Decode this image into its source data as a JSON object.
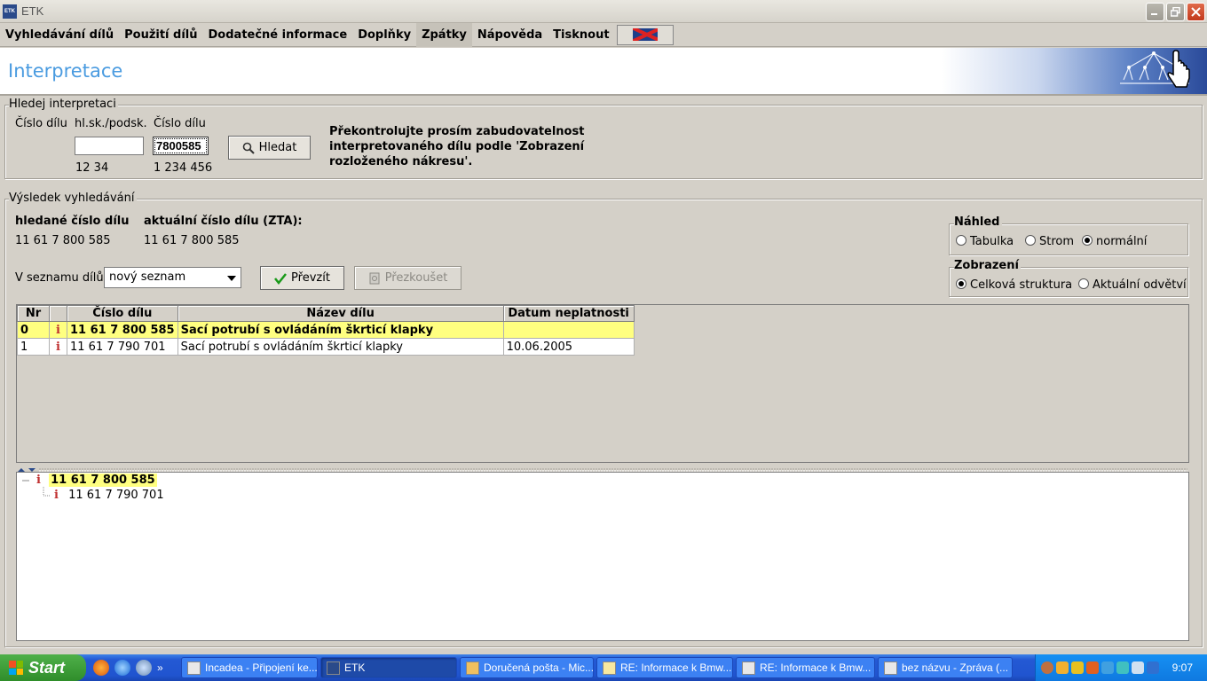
{
  "window": {
    "title": "ETK",
    "icon_label": "ETK"
  },
  "menu": [
    {
      "label": "Vyhledávání dílů"
    },
    {
      "label": "Použití dílů"
    },
    {
      "label": "Dodatečné informace"
    },
    {
      "label": "Doplňky"
    },
    {
      "label": "Zpátky",
      "active": true
    },
    {
      "label": "Nápověda"
    },
    {
      "label": "Tisknout"
    }
  ],
  "header": {
    "title": "Interpretace"
  },
  "search": {
    "group_title": "Hledej interpretaci",
    "label_cislo_dilu": "Číslo dílu",
    "label_hlsk": "hl.sk./podsk.",
    "label_cislo_dilu2": "Číslo dílu",
    "hlsk_value": "",
    "part_value": "7800585",
    "hint_hlsk": "12 34",
    "hint_part": "1 234 456",
    "search_button": "Hledat",
    "notice": "Překontrolujte prosím zabudovatelnost interpretovaného dílu podle 'Zobrazení rozloženého nákresu'."
  },
  "result": {
    "group_title": "Výsledek vyhledávání",
    "searched_label": "hledané číslo dílu",
    "searched_value": "11 61 7 800 585",
    "current_label": "aktuální číslo dílu (ZTA):",
    "current_value": "11 61 7 800 585",
    "list_label": "V seznamu dílů",
    "list_value": "nový seznam",
    "take_button": "Převzít",
    "check_button": "Přezkoušet"
  },
  "nahled": {
    "title": "Náhled",
    "options": [
      "Tabulka",
      "Strom",
      "normální"
    ],
    "selected": "normální"
  },
  "zobrazeni": {
    "title": "Zobrazení",
    "options": [
      "Celková struktura",
      "Aktuální odvětví"
    ],
    "selected": "Celková struktura"
  },
  "table": {
    "columns": [
      "Nr",
      "",
      "Číslo dílu",
      "Název dílu",
      "Datum neplatnosti"
    ],
    "rows": [
      {
        "nr": "0",
        "icon": "i",
        "part": "11 61 7 800 585",
        "name": "Sací potrubí s ovládáním škrticí klapky",
        "date": "",
        "selected": true
      },
      {
        "nr": "1",
        "icon": "i",
        "part": "11 61 7 790 701",
        "name": "Sací potrubí s ovládáním škrticí klapky",
        "date": "10.06.2005",
        "selected": false
      }
    ]
  },
  "tree": {
    "root": {
      "icon": "i",
      "label": "11 61 7 800 585"
    },
    "child": {
      "icon": "i",
      "label": "11 61 7 790 701"
    }
  },
  "taskbar": {
    "start": "Start",
    "tasks": [
      {
        "label": "Incadea - Připojení ke..."
      },
      {
        "label": "ETK",
        "active": true
      },
      {
        "label": "Doručená pošta - Mic..."
      },
      {
        "label": "RE: Informace k Bmw..."
      },
      {
        "label": "RE: Informace k Bmw..."
      },
      {
        "label": "bez názvu - Zpráva (..."
      }
    ],
    "clock": "9:07"
  }
}
